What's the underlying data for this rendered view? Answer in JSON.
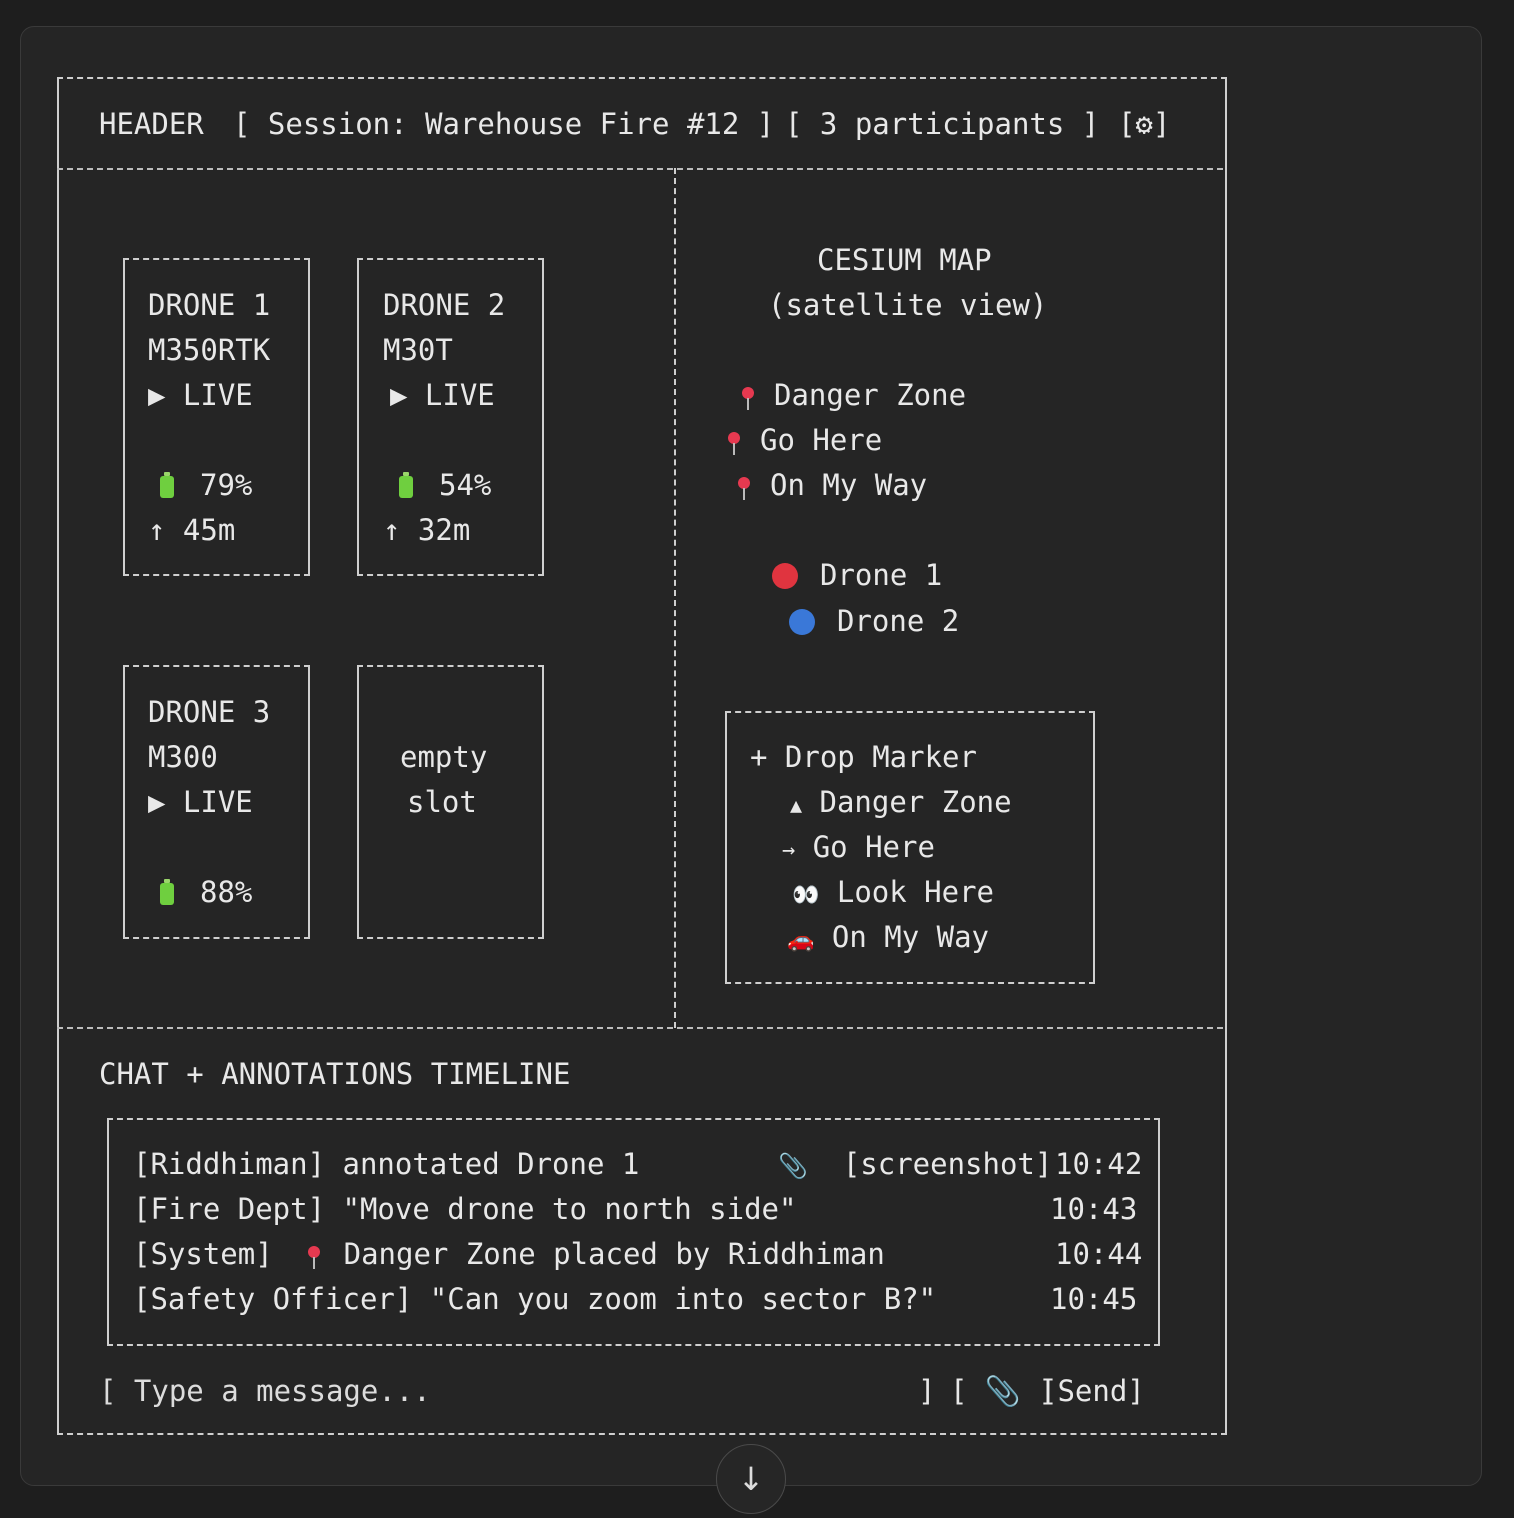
{
  "header": {
    "label": "HEADER",
    "session": "[ Session: Warehouse Fire #12 ]",
    "participants": "[ 3 participants ]",
    "settings": "[⚙]"
  },
  "drones": [
    {
      "name": "DRONE 1",
      "model": "M350RTK",
      "status": "▶ LIVE",
      "battery": "79%",
      "altitude": "↑ 45m"
    },
    {
      "name": "DRONE 2",
      "model": "M30T",
      "status": "▶ LIVE",
      "battery": "54%",
      "altitude": "↑ 32m"
    },
    {
      "name": "DRONE 3",
      "model": "M300",
      "status": "▶ LIVE",
      "battery": "88%",
      "altitude": ""
    }
  ],
  "empty_slot": {
    "line1": "empty",
    "line2": "slot"
  },
  "map": {
    "title": "CESIUM MAP",
    "subtitle": "(satellite view)",
    "markers": [
      "Danger Zone",
      "Go Here",
      "On My Way"
    ],
    "drone_markers": [
      {
        "label": "Drone 1",
        "color": "#e0343f"
      },
      {
        "label": "Drone 2",
        "color": "#3a78d8"
      }
    ],
    "drop_menu": {
      "title": "+ Drop Marker",
      "items": [
        {
          "icon": "▲",
          "label": "Danger Zone"
        },
        {
          "icon": "→",
          "label": "Go Here"
        },
        {
          "icon": "👀",
          "label": "Look Here"
        },
        {
          "icon": "🚗",
          "label": "On My Way"
        }
      ]
    }
  },
  "chat": {
    "title": "CHAT + ANNOTATIONS TIMELINE",
    "messages": [
      {
        "text": "[Riddhiman] annotated Drone 1",
        "attachment": "[screenshot]",
        "time": "10:42"
      },
      {
        "text": "[Fire Dept] \"Move drone to north side\"",
        "attachment": "",
        "time": "10:43"
      },
      {
        "text": "[System]",
        "text2": "Danger Zone placed by Riddhiman",
        "attachment": "",
        "time": "10:44"
      },
      {
        "text": "[Safety Officer] \"Can you zoom into sector B?\"",
        "attachment": "",
        "time": "10:45"
      }
    ],
    "input_placeholder": "[ Type a message...",
    "input_close": "]",
    "attach_button": "[ 📎 ]",
    "send_button": "[Send]"
  },
  "colors": {
    "background": "#1e1e1e",
    "card": "#252525",
    "text": "#e6e6e6",
    "accent_red": "#e0343f",
    "accent_blue": "#3a78d8",
    "battery_green": "#6fcf3f"
  }
}
